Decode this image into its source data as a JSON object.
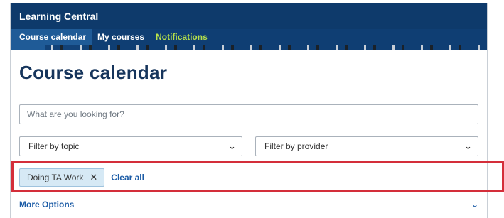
{
  "app": {
    "title": "Learning Central"
  },
  "nav": {
    "tabs": [
      {
        "label": "Course calendar"
      },
      {
        "label": "My courses"
      },
      {
        "label": "Notifications"
      }
    ]
  },
  "page": {
    "title": "Course calendar"
  },
  "search": {
    "placeholder": "What are you looking for?"
  },
  "filters": {
    "topic": {
      "label": "Filter by topic"
    },
    "provider": {
      "label": "Filter by provider"
    }
  },
  "active_filters": {
    "chips": [
      {
        "label": "Doing TA Work"
      }
    ],
    "clear_all": "Clear all"
  },
  "more_options": {
    "label": "More Options"
  },
  "colors": {
    "header_bg": "#0e3a6b",
    "accent_green": "#b9e34a",
    "link_blue": "#1c5ca6",
    "highlight_red": "#d42e3a",
    "chip_bg": "#d6e9f5"
  }
}
